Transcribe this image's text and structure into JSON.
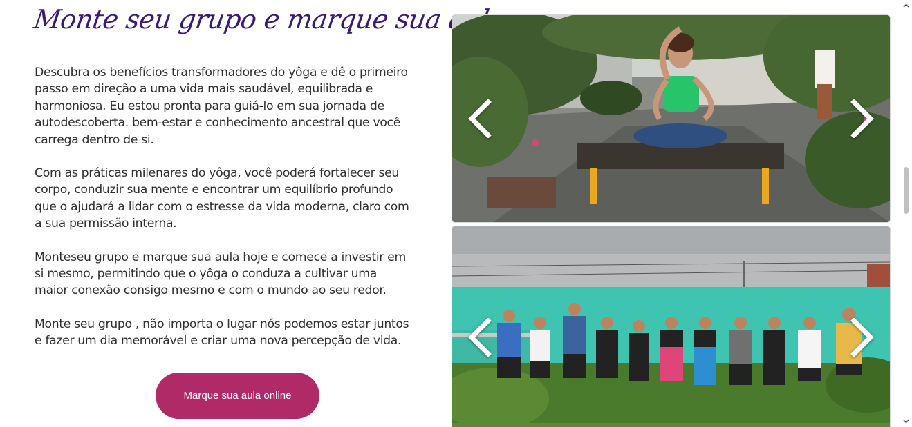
{
  "section": {
    "heading": "Monte seu grupo e marque sua aula",
    "paragraphs": [
      "Descubra os benefícios transformadores do yôga e dê o primeiro passo em direção a uma vida mais saudável, equilibrada e harmoniosa. Eu estou pronta para guiá-lo em sua jornada de autodescoberta. bem-estar e conhecimento ancestral que você carrega dentro de si.",
      "Com as práticas milenares do yôga, você poderá fortalecer seu corpo, conduzir sua mente e encontrar um equilíbrio profundo que o ajudará a lidar com o estresse da vida moderna, claro com a sua permissão interna.",
      "Monteseu grupo e marque sua aula hoje e comece a investir em si mesmo, permitindo que o yôga o conduza a cultivar uma maior conexão consigo mesmo e com o mundo ao seu redor.",
      "Monte seu grupo , não importa o lugar nós podemos estar juntos e fazer um dia memorável e criar uma nova percepção de vida."
    ],
    "cta_label": "Marque sua aula online"
  },
  "carousels": [
    {
      "prev_icon": "chevron-left-icon",
      "next_icon": "chevron-right-icon"
    },
    {
      "prev_icon": "chevron-left-icon",
      "next_icon": "chevron-right-icon"
    }
  ],
  "colors": {
    "heading": "#3a1a78",
    "body_text": "#2f2f2f",
    "cta_background": "#b02a68",
    "cta_text": "#ffffff",
    "wall_teal": "#3fc4b1"
  },
  "scrollbar": {
    "up_icon": "scroll-up-arrow-icon",
    "down_icon": "scroll-down-arrow-icon"
  }
}
